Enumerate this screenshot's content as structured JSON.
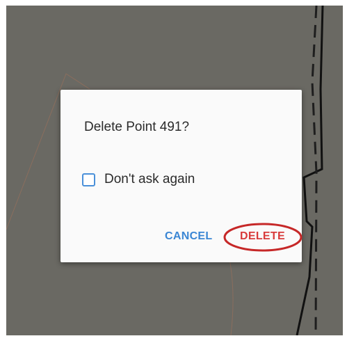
{
  "dialog": {
    "title": "Delete Point 491?",
    "checkbox_label": "Don't ask again",
    "checkbox_checked": false,
    "cancel_label": "CANCEL",
    "delete_label": "DELETE"
  },
  "colors": {
    "map_background": "#6a6963",
    "dialog_background": "#fafafa",
    "accent_blue": "#3a86d4",
    "delete_red": "#d83b3b",
    "highlight_ring": "#c62828"
  }
}
